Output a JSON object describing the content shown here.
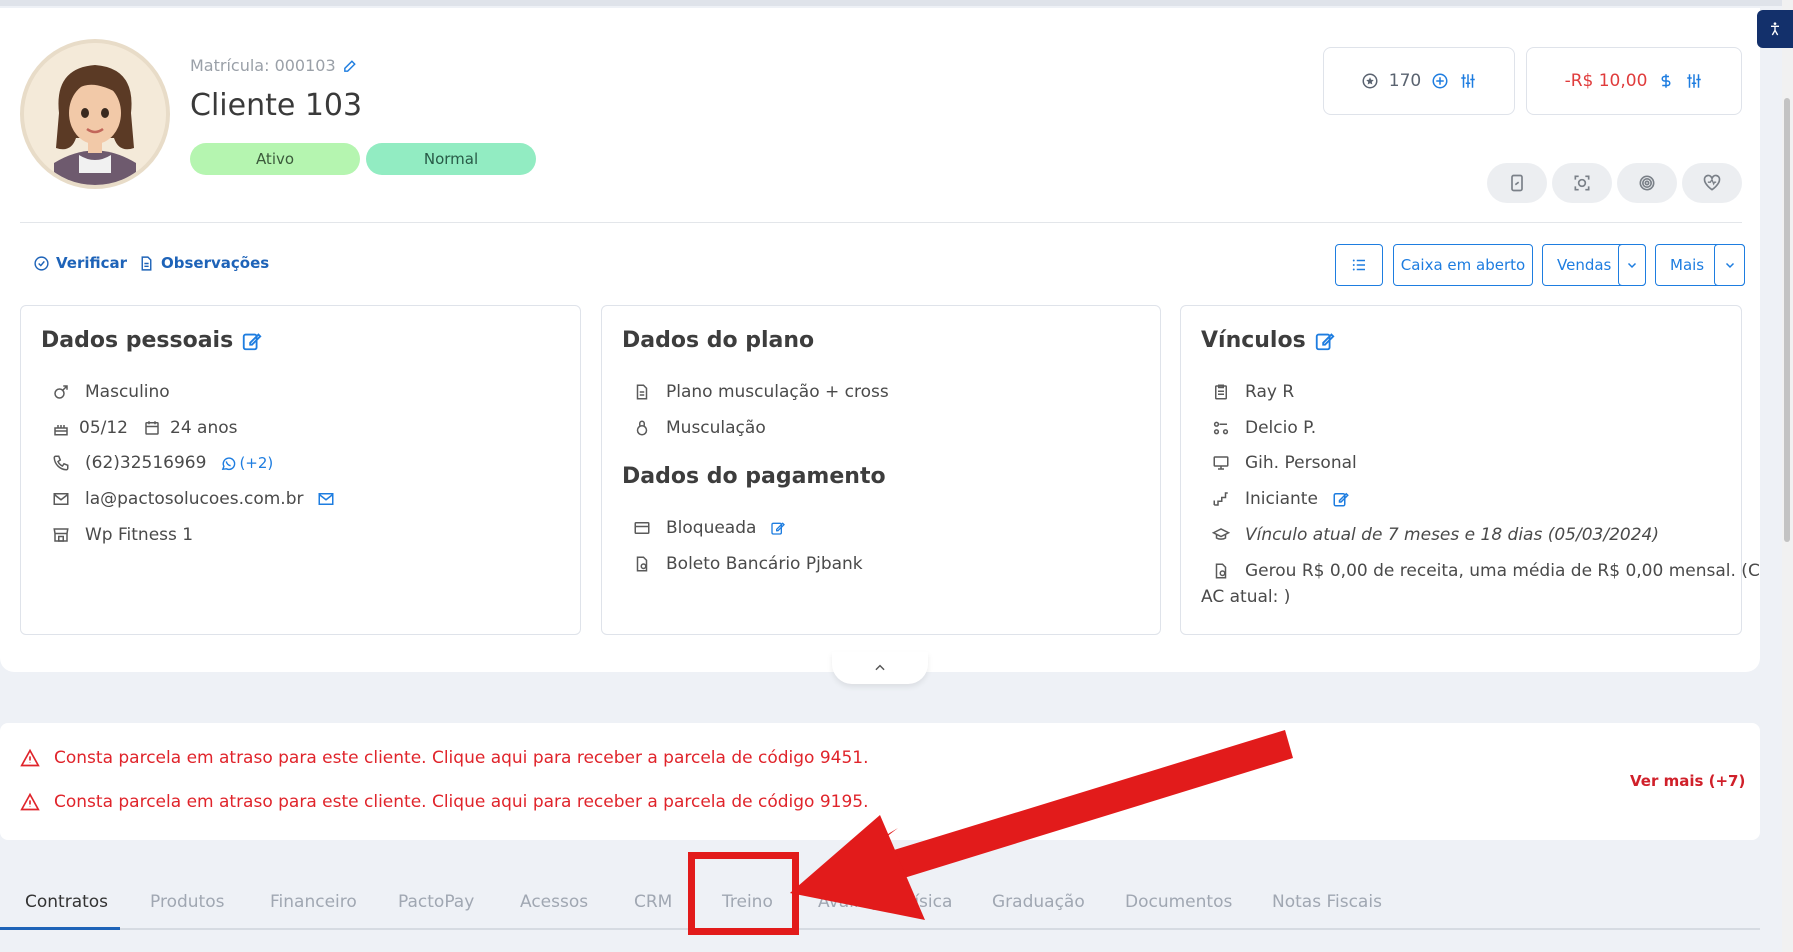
{
  "client": {
    "matricula": "Matrícula: 000103",
    "name": "Cliente 103",
    "status": "Ativo",
    "situation": "Normal"
  },
  "scores": {
    "points": "170",
    "balance": "-R$ 10,00"
  },
  "actions": {
    "verificar": "Verificar",
    "observacoes": "Observações",
    "caixa": "Caixa em aberto",
    "vendas": "Vendas",
    "mais": "Mais"
  },
  "dados_pessoais": {
    "title": "Dados pessoais",
    "gender": "Masculino",
    "birthday": "05/12",
    "age": "24 anos",
    "phone": "(62)32516969",
    "whatsapp_extra": "(+2)",
    "email": "la@pactosolucoes.com.br",
    "unit": "Wp Fitness 1"
  },
  "dados_plano": {
    "title": "Dados do plano",
    "plan": "Plano musculação + cross",
    "modality": "Musculação"
  },
  "dados_pagamento": {
    "title": "Dados do pagamento",
    "card": "Bloqueada",
    "method": "Boleto Bancário Pjbank"
  },
  "vinculos": {
    "title": "Vínculos",
    "consultor": "Ray R",
    "professor": "Delcio P.",
    "personal": "Gih. Personal",
    "level": "Iniciante",
    "vinculo_atual": "Vínculo atual de 7 meses e 18 dias (05/03/2024)",
    "receita_line1": "Gerou R$ 0,00 de receita, uma média de R$ 0,00 mensal. (C",
    "receita_line2": "AC atual: )"
  },
  "alerts": [
    "Consta parcela em atraso para este cliente. Clique aqui para receber a parcela de código 9451.",
    "Consta parcela em atraso para este cliente. Clique aqui para receber a parcela de código 9195."
  ],
  "alerts_more": "Ver mais (+7)",
  "tabs": [
    "Contratos",
    "Produtos",
    "Financeiro",
    "PactoPay",
    "Acessos",
    "CRM",
    "Treino",
    "Avaliação Física",
    "Graduação",
    "Documentos",
    "Notas Fiscais"
  ],
  "colors": {
    "accent": "#1e7de0",
    "danger": "#e0242b",
    "annotation": "#e21b1b"
  }
}
